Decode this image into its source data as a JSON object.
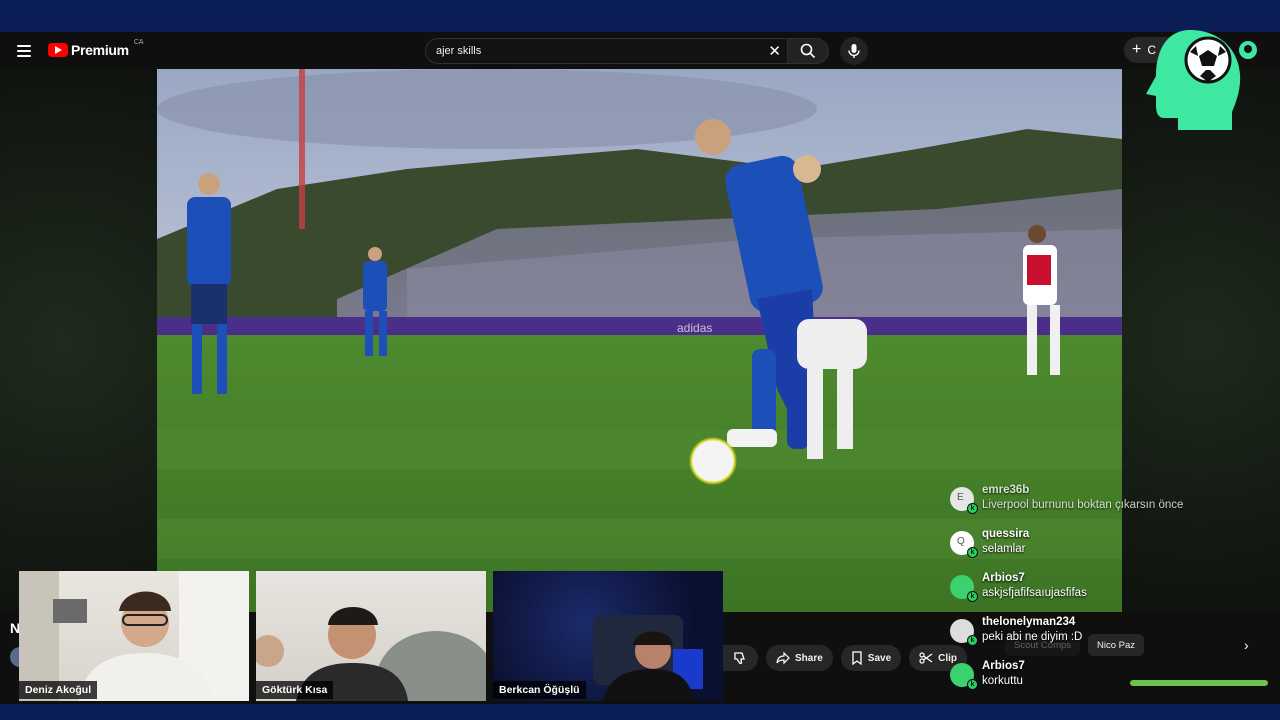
{
  "header": {
    "logo_text": "Premium",
    "logo_region": "CA",
    "search_value": "ajer skills",
    "create_label": "C"
  },
  "video": {
    "ad_text": "adidas"
  },
  "below": {
    "title_initial": "N"
  },
  "actions": {
    "share": "Share",
    "save": "Save",
    "clip": "Clip"
  },
  "chips": [
    "Scout Comps",
    "Nico Paz"
  ],
  "chat": [
    {
      "name": "emre36b",
      "text": "Liverpool burnunu boktan çıkarsın önce",
      "avatar_letter": "E",
      "avatar_color": "#e6e6e6",
      "dim": true
    },
    {
      "name": "quessira",
      "text": "selamlar",
      "avatar_letter": "Q",
      "avatar_color": "#ffffff",
      "dim": false
    },
    {
      "name": "Arbios7",
      "text": "askjsfjafifsaıujasfifas",
      "avatar_letter": "",
      "avatar_color": "#3bd16f",
      "dim": false
    },
    {
      "name": "thelonelyman234",
      "text": "peki abi ne diyim :D",
      "avatar_letter": "",
      "avatar_color": "#dddddd",
      "dim": false
    },
    {
      "name": "Arbios7",
      "text": "korkuttu",
      "avatar_letter": "",
      "avatar_color": "#3bd16f",
      "dim": false
    }
  ],
  "cams": [
    {
      "name": "Deniz Akoğul"
    },
    {
      "name": "Göktürk Kısa"
    },
    {
      "name": "Berkcan Öğüşlü"
    }
  ],
  "colors": {
    "brand_green": "#3ee8a0",
    "youtube_red": "#ff0000",
    "badge_green": "#25d366"
  }
}
